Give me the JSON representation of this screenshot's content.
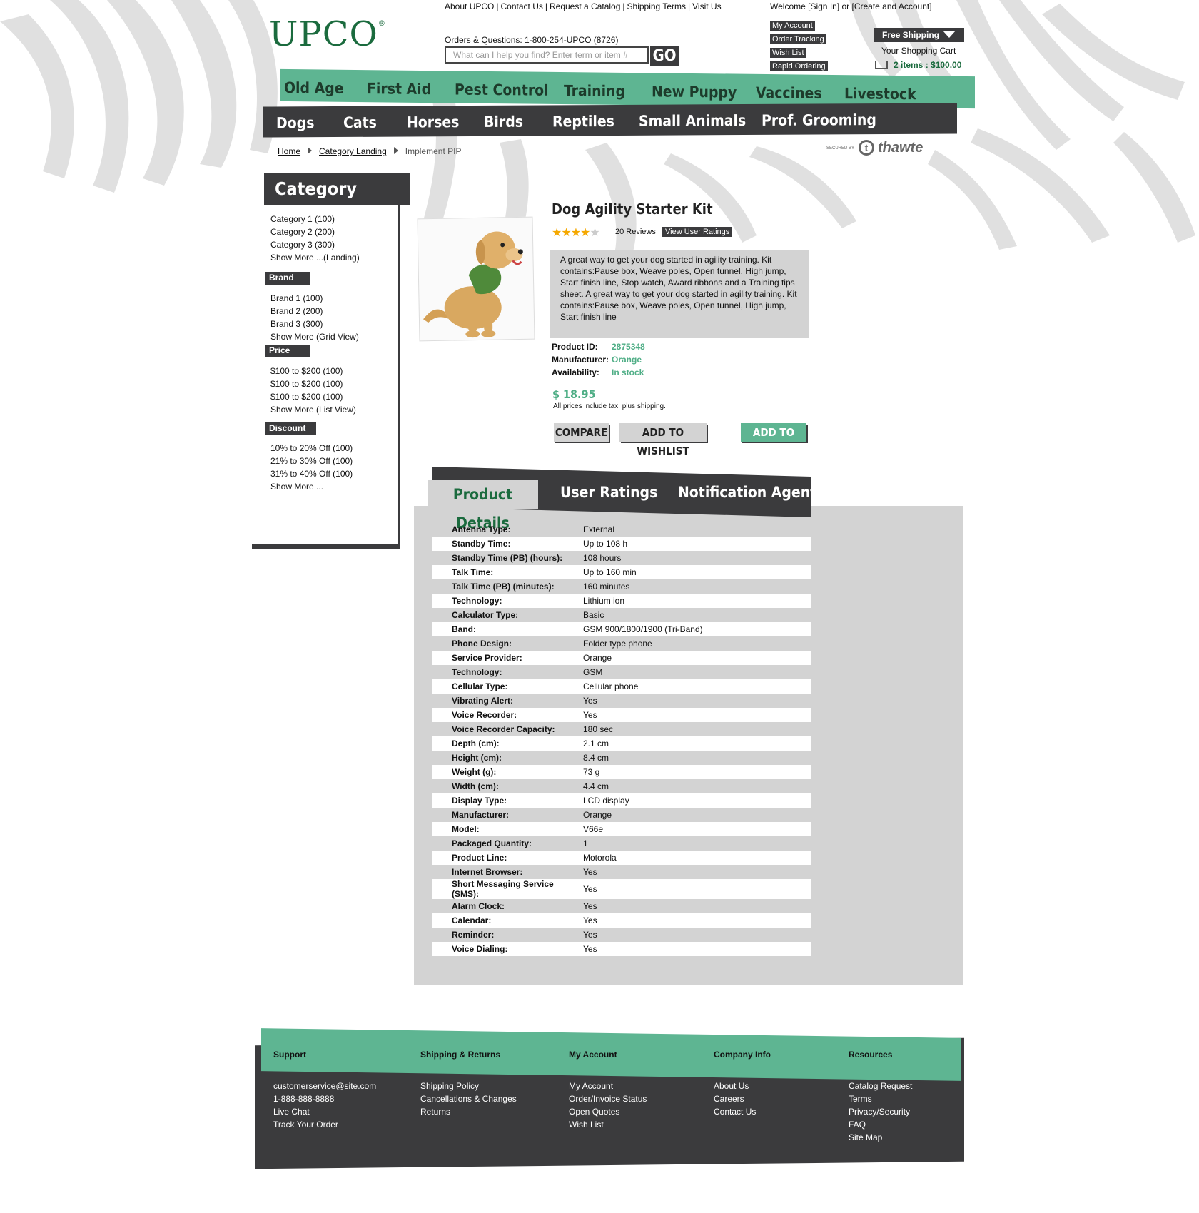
{
  "header": {
    "logo": "UPCO",
    "top_links": [
      "About UPCO",
      "Contact Us",
      "Request a Catalog",
      "Shipping Terms",
      "Visit Us"
    ],
    "welcome": "Welcome [Sign In] or [Create and Account]",
    "orders": "Orders & Questions: 1-800-254-UPCO (8726)",
    "search_placeholder": "What can I help you find? Enter term or item #",
    "go_label": "GO",
    "account_links": [
      "My Account",
      "Order Tracking",
      "Wish List",
      "Rapid Ordering"
    ],
    "free_shipping": "Free Shipping",
    "cart_title": "Your Shopping Cart",
    "cart_summary": "2 items : $100.00"
  },
  "nav_primary": [
    "Old Age",
    "First Aid",
    "Pest Control",
    "Training",
    "New Puppy",
    "Vaccines",
    "Livestock"
  ],
  "nav_secondary": [
    "Dogs",
    "Cats",
    "Horses",
    "Birds",
    "Reptiles",
    "Small Animals",
    "Prof. Grooming"
  ],
  "breadcrumb": {
    "home": "Home",
    "category": "Category Landing",
    "current": "Implement PIP"
  },
  "trust_seal": {
    "secured_by": "SECURED BY",
    "brand": "thawte"
  },
  "sidebar": {
    "title": "Category",
    "categories": [
      "Category 1 (100)",
      "Category 2 (200)",
      "Category 3 (300)",
      "Show More ...(Landing)"
    ],
    "brand_title": "Brand",
    "brands": [
      "Brand 1 (100)",
      "Brand 2 (200)",
      "Brand 3 (300)",
      "Show More (Grid View)"
    ],
    "price_title": "Price",
    "prices": [
      "$100 to $200 (100)",
      "$100 to $200 (100)",
      "$100 to $200 (100)",
      "Show More (List View)"
    ],
    "discount_title": "Discount",
    "discounts": [
      "10% to 20% Off (100)",
      "21% to 30% Off (100)",
      "31% to 40% Off (100)",
      "Show More ..."
    ]
  },
  "product": {
    "title": "Dog Agility Starter Kit",
    "rating": 4,
    "rating_max": 5,
    "reviews": "20 Reviews",
    "view_ratings": "View User Ratings",
    "description": "A great way to get your dog started in agility training. Kit contains:Pause box, Weave poles, Open tunnel, High jump, Start finish line, Stop watch, Award ribbons and a Training tips sheet. A great way to get your dog started in agility training. Kit contains:Pause box, Weave poles, Open tunnel, High jump, Start finish line",
    "id_label": "Product ID:",
    "id_value": "2875348",
    "manufacturer_label": "Manufacturer:",
    "manufacturer_value": "Orange",
    "availability_label": "Availability:",
    "availability_value": "In stock",
    "price": "$ 18.95",
    "price_note": "All prices include tax, plus shipping.",
    "compare": "COMPARE",
    "wishlist": "ADD TO WISHLIST",
    "add_to_cart": "ADD TO CART"
  },
  "tabs": [
    "Product Details",
    "User Ratings",
    "Notification Agent"
  ],
  "specs": [
    [
      "Antenna Type:",
      "External"
    ],
    [
      "Standby Time:",
      "Up to 108 h"
    ],
    [
      "Standby Time (PB) (hours):",
      "108 hours"
    ],
    [
      "Talk Time:",
      "Up to 160 min"
    ],
    [
      "Talk Time (PB) (minutes):",
      "160 minutes"
    ],
    [
      "Technology:",
      "Lithium ion"
    ],
    [
      "Calculator Type:",
      "Basic"
    ],
    [
      "Band:",
      "GSM 900/1800/1900 (Tri-Band)"
    ],
    [
      "Phone Design:",
      "Folder type phone"
    ],
    [
      "Service Provider:",
      "Orange"
    ],
    [
      "Technology:",
      "GSM"
    ],
    [
      "Cellular Type:",
      "Cellular phone"
    ],
    [
      "Vibrating Alert:",
      "Yes"
    ],
    [
      "Voice Recorder:",
      "Yes"
    ],
    [
      "Voice Recorder Capacity:",
      "180 sec"
    ],
    [
      "Depth (cm):",
      "2.1 cm"
    ],
    [
      "Height (cm):",
      "8.4 cm"
    ],
    [
      "Weight (g):",
      "73 g"
    ],
    [
      "Width (cm):",
      "4.4 cm"
    ],
    [
      "Display Type:",
      "LCD display"
    ],
    [
      "Manufacturer:",
      "Orange"
    ],
    [
      "Model:",
      "V66e"
    ],
    [
      "Packaged Quantity:",
      "1"
    ],
    [
      "Product Line:",
      "Motorola"
    ],
    [
      "Internet Browser:",
      "Yes"
    ],
    [
      "Short Messaging Service (SMS):",
      "Yes"
    ],
    [
      "Alarm Clock:",
      "Yes"
    ],
    [
      "Calendar:",
      "Yes"
    ],
    [
      "Reminder:",
      "Yes"
    ],
    [
      "Voice Dialing:",
      "Yes"
    ]
  ],
  "footer": {
    "columns": [
      {
        "title": "Support",
        "links": [
          "customerservice@site.com",
          "1-888-888-8888",
          "Live Chat",
          "Track Your Order"
        ]
      },
      {
        "title": "Shipping & Returns",
        "links": [
          "Shipping Policy",
          "Cancellations & Changes",
          "Returns"
        ]
      },
      {
        "title": "My Account",
        "links": [
          "My Account",
          "Order/Invoice Status",
          "Open Quotes",
          "Wish List"
        ]
      },
      {
        "title": "Company Info",
        "links": [
          "About Us",
          "Careers",
          "Contact Us"
        ]
      },
      {
        "title": "Resources",
        "links": [
          "Catalog Request",
          "Terms",
          "Privacy/Security",
          "FAQ",
          "Site Map"
        ]
      }
    ]
  },
  "colors": {
    "brand_green": "#5eb592",
    "dark": "#3b3b3d",
    "logo_green": "#1b6b3e",
    "panel_grey": "#d3d3d3"
  }
}
